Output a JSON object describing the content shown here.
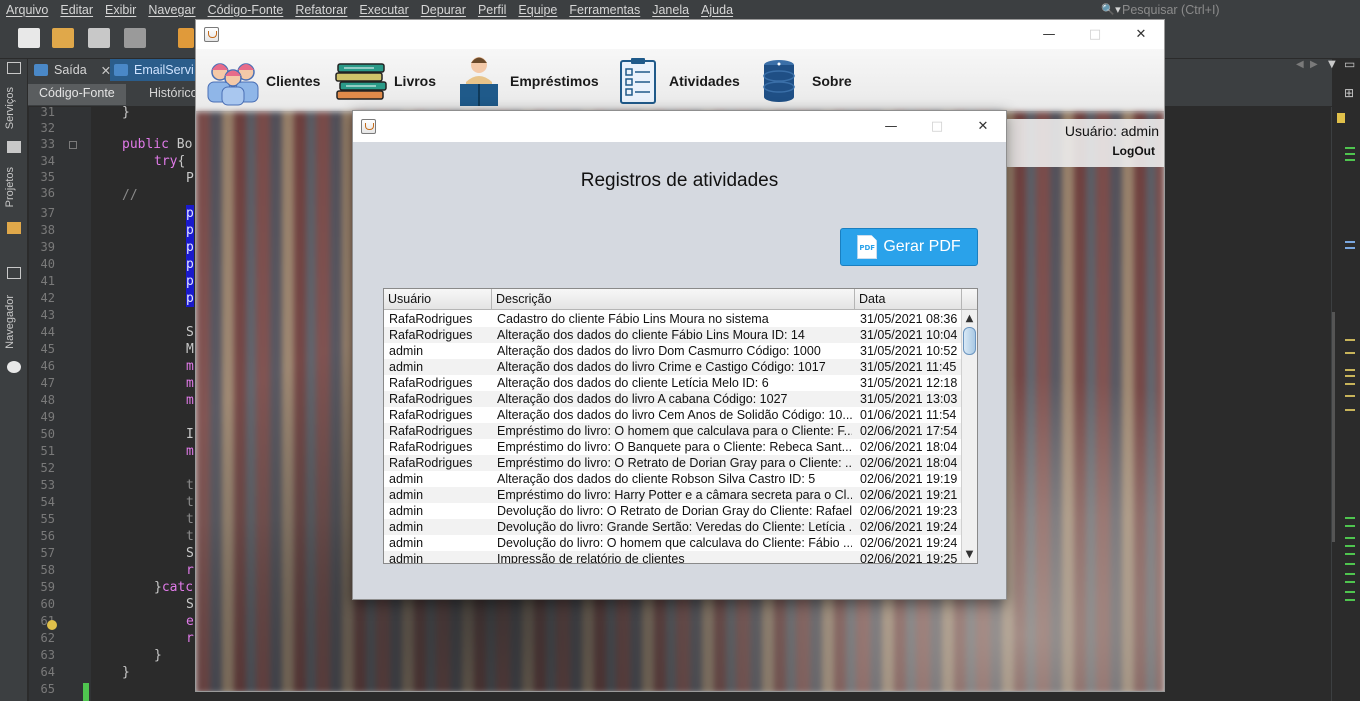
{
  "ide": {
    "menu": [
      "Arquivo",
      "Editar",
      "Exibir",
      "Navegar",
      "Código-Fonte",
      "Refatorar",
      "Executar",
      "Depurar",
      "Perfil",
      "Equipe",
      "Ferramentas",
      "Janela",
      "Ajuda"
    ],
    "search_placeholder": "Pesquisar (Ctrl+I)",
    "tabs": [
      "Saída",
      "EmailServi"
    ],
    "subtabs": [
      "Código-Fonte",
      "Histórico"
    ],
    "side_labels": [
      "Serviços",
      "Projetos",
      "Navegador"
    ],
    "line_numbers": [
      "31",
      "32",
      "33",
      "34",
      "35",
      "36",
      "37",
      "38",
      "39",
      "40",
      "41",
      "42",
      "43",
      "44",
      "45",
      "46",
      "47",
      "48",
      "49",
      "50",
      "51",
      "52",
      "53",
      "54",
      "55",
      "56",
      "57",
      "58",
      "59",
      "60",
      "61",
      "62",
      "63",
      "64",
      "65"
    ],
    "code": {
      "l31": "}",
      "l33_kw": "public",
      "l33_rest": " Bo",
      "l34_kw": "try",
      "l34_rest": "{",
      "l35": "P",
      "l36": "//",
      "l37": "p",
      "l38": "p",
      "l39": "p",
      "l40": "p",
      "l41": "p",
      "l42": "p",
      "l44": "S",
      "l45": "M",
      "l46": "m",
      "l47": "m",
      "l48": "m",
      "l50": "I",
      "l51": "m",
      "l53": "t",
      "l54": "t",
      "l55": "t",
      "l56": "t",
      "l57": "S",
      "l58": "r",
      "l59_a": "}",
      "l59_kw": "catc",
      "l60": "S",
      "l61": "e",
      "l62": "r",
      "l63": "}",
      "l64": "}"
    }
  },
  "app": {
    "menu": [
      {
        "label": "Clientes",
        "icon": "users-icon"
      },
      {
        "label": "Livros",
        "icon": "books-icon"
      },
      {
        "label": "Empréstimos",
        "icon": "reader-icon"
      },
      {
        "label": "Atividades",
        "icon": "checklist-icon"
      },
      {
        "label": "Sobre",
        "icon": "database-icon"
      }
    ],
    "user_label": "Usuário: admin",
    "logout": "LogOut"
  },
  "dialog": {
    "title": "Registros de atividades",
    "pdf_button": "Gerar PDF",
    "pdf_icon_text": "PDF",
    "columns": [
      "Usuário",
      "Descrição",
      "Data"
    ],
    "rows": [
      [
        "RafaRodrigues",
        "Cadastro do cliente Fábio Lins Moura no sistema",
        "31/05/2021 08:36"
      ],
      [
        "RafaRodrigues",
        "Alteração dos dados do cliente Fábio Lins Moura ID: 14",
        "31/05/2021 10:04"
      ],
      [
        "admin",
        "Alteração dos dados do livro Dom Casmurro Código: 1000",
        "31/05/2021 10:52"
      ],
      [
        "admin",
        "Alteração dos dados do livro Crime e Castigo Código: 1017",
        "31/05/2021 11:45"
      ],
      [
        "RafaRodrigues",
        "Alteração dos dados do cliente Letícia Melo ID: 6",
        "31/05/2021 12:18"
      ],
      [
        "RafaRodrigues",
        "Alteração dos dados do livro A cabana Código: 1027",
        "31/05/2021 13:03"
      ],
      [
        "RafaRodrigues",
        "Alteração dos dados do livro Cem Anos de Solidão Código: 10...",
        "01/06/2021 11:54"
      ],
      [
        "RafaRodrigues",
        "Empréstimo do livro: O homem que calculava para o Cliente: F...",
        "02/06/2021 17:54"
      ],
      [
        "RafaRodrigues",
        "Empréstimo do livro: O Banquete para o Cliente: Rebeca Sant...",
        "02/06/2021 18:04"
      ],
      [
        "RafaRodrigues",
        "Empréstimo do livro: O Retrato de Dorian Gray para o Cliente: ...",
        "02/06/2021 18:04"
      ],
      [
        "admin",
        "Alteração dos dados do cliente Robson Silva Castro ID: 5",
        "02/06/2021 19:19"
      ],
      [
        "admin",
        "Empréstimo do livro: Harry Potter e a câmara secreta para o Cl...",
        "02/06/2021 19:21"
      ],
      [
        "admin",
        "Devolução do livro: O Retrato de Dorian Gray do Cliente: Rafael...",
        "02/06/2021 19:23"
      ],
      [
        "admin",
        "Devolução do livro: Grande Sertão: Veredas do Cliente: Letícia ...",
        "02/06/2021 19:24"
      ],
      [
        "admin",
        "Devolução do livro: O homem que calculava do Cliente: Fábio ...",
        "02/06/2021 19:24"
      ],
      [
        "admin",
        "Impressão de relatório de clientes",
        "02/06/2021 19:25"
      ]
    ]
  }
}
